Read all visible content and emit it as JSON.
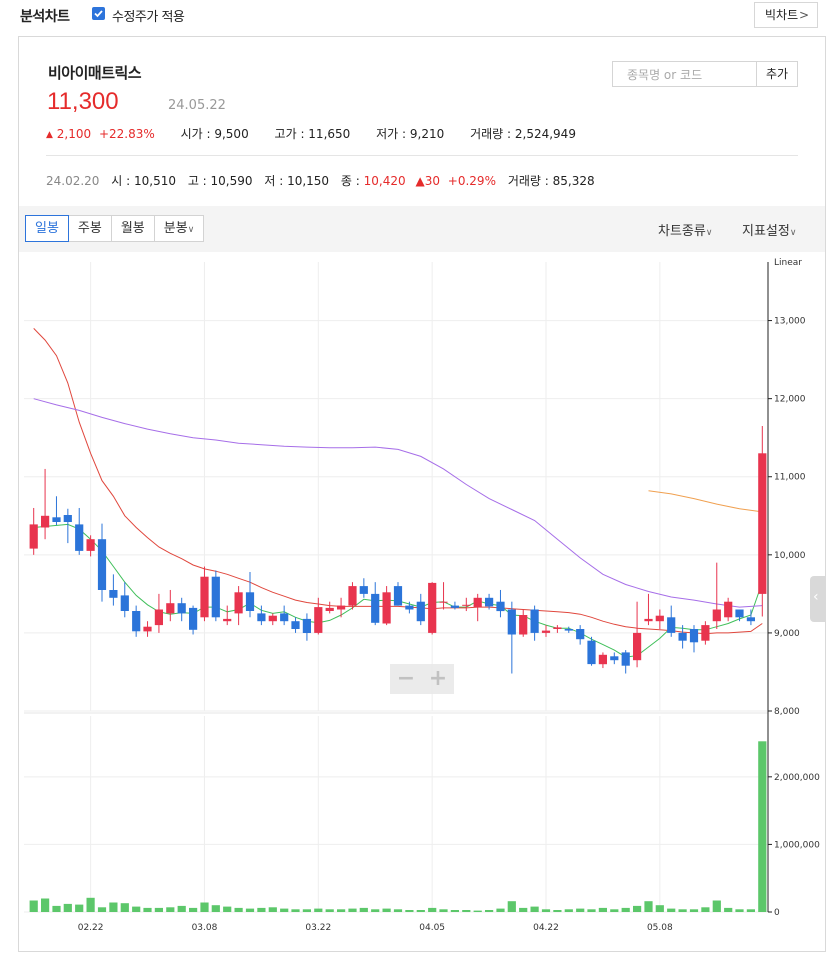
{
  "header": {
    "title": "분석차트",
    "adjusted_price_label": "수정주가 적용",
    "adjusted_price_checked": true,
    "big_chart_label": "빅차트",
    "big_chart_chevron": ">"
  },
  "stock": {
    "name": "비아이매트릭스",
    "price": "11,300",
    "date": "24.05.22",
    "change_arrow": "▲",
    "change": "2,100",
    "change_pct": "+22.83%",
    "open_label": "시가",
    "open": "9,500",
    "high_label": "고가",
    "high": "11,650",
    "low_label": "저가",
    "low": "9,210",
    "volume_label": "거래량",
    "volume": "2,524,949"
  },
  "search": {
    "placeholder": "종목명 or 코드",
    "value": "",
    "add_label": "추가"
  },
  "crosshair": {
    "date": "24.02.20",
    "open_label": "시",
    "open": "10,510",
    "high_label": "고",
    "high": "10,590",
    "low_label": "저",
    "low": "10,150",
    "close_label": "종",
    "close": "10,420",
    "change_arrow": "▲",
    "change": "30",
    "change_pct": "+0.29%",
    "volume_label": "거래량",
    "volume": "85,328"
  },
  "toolbar": {
    "tabs": [
      "일봉",
      "주봉",
      "월봉",
      "분봉"
    ],
    "active_tab": "일봉",
    "minute_chevron": "∨",
    "chart_type_label": "차트종류",
    "indicator_label": "지표설정",
    "dropdown_chevron": "∨"
  },
  "zoom": {
    "minus": "−",
    "plus": "+"
  },
  "colors": {
    "up": "#e8344e",
    "down": "#2b74d9",
    "ma5": "#3fbf5a",
    "ma20": "#e0473d",
    "ma60": "#a66ee8",
    "ma120": "#f0a050",
    "volume": "#5cc76a",
    "accent": "#2d74db"
  },
  "chart_data": {
    "type": "candlestick",
    "scale_label": "Linear",
    "price_axis": {
      "ylim": [
        8000,
        13750
      ],
      "ticks": [
        "13,000",
        "12,000",
        "11,000",
        "10,000",
        "9,000",
        "8,000"
      ],
      "tick_values": [
        13000,
        12000,
        11000,
        10000,
        9000,
        8000
      ]
    },
    "volume_axis": {
      "ylim": [
        0,
        2900000
      ],
      "ticks": [
        "2,000,000",
        "1,000,000",
        "0"
      ],
      "tick_values": [
        2000000,
        1000000,
        0
      ]
    },
    "x_ticks": [
      "02.22",
      "03.08",
      "03.22",
      "04.05",
      "04.22",
      "05.08"
    ],
    "x_tick_index": [
      5,
      15,
      25,
      35,
      45,
      55
    ],
    "candles": [
      {
        "o": 10080,
        "h": 10600,
        "l": 10000,
        "c": 10390
      },
      {
        "o": 10350,
        "h": 11100,
        "l": 10200,
        "c": 10500
      },
      {
        "o": 10480,
        "h": 10750,
        "l": 10380,
        "c": 10420
      },
      {
        "o": 10510,
        "h": 10590,
        "l": 10150,
        "c": 10420
      },
      {
        "o": 10390,
        "h": 10600,
        "l": 10000,
        "c": 10050
      },
      {
        "o": 10050,
        "h": 10250,
        "l": 9980,
        "c": 10200
      },
      {
        "o": 10200,
        "h": 10400,
        "l": 9400,
        "c": 9550
      },
      {
        "o": 9550,
        "h": 9750,
        "l": 9350,
        "c": 9450
      },
      {
        "o": 9480,
        "h": 9650,
        "l": 9200,
        "c": 9280
      },
      {
        "o": 9280,
        "h": 9350,
        "l": 8950,
        "c": 9020
      },
      {
        "o": 9020,
        "h": 9150,
        "l": 8950,
        "c": 9080
      },
      {
        "o": 9100,
        "h": 9500,
        "l": 9000,
        "c": 9300
      },
      {
        "o": 9250,
        "h": 9550,
        "l": 9150,
        "c": 9380
      },
      {
        "o": 9380,
        "h": 9450,
        "l": 9150,
        "c": 9250
      },
      {
        "o": 9320,
        "h": 9350,
        "l": 8980,
        "c": 9040
      },
      {
        "o": 9200,
        "h": 9850,
        "l": 9150,
        "c": 9720
      },
      {
        "o": 9720,
        "h": 9800,
        "l": 9150,
        "c": 9200
      },
      {
        "o": 9150,
        "h": 9350,
        "l": 9100,
        "c": 9180
      },
      {
        "o": 9250,
        "h": 9600,
        "l": 9100,
        "c": 9520
      },
      {
        "o": 9520,
        "h": 9780,
        "l": 9200,
        "c": 9280
      },
      {
        "o": 9250,
        "h": 9350,
        "l": 9100,
        "c": 9150
      },
      {
        "o": 9150,
        "h": 9250,
        "l": 9100,
        "c": 9220
      },
      {
        "o": 9250,
        "h": 9350,
        "l": 9100,
        "c": 9150
      },
      {
        "o": 9150,
        "h": 9200,
        "l": 9000,
        "c": 9050
      },
      {
        "o": 9180,
        "h": 9250,
        "l": 8900,
        "c": 9000
      },
      {
        "o": 9000,
        "h": 9450,
        "l": 8980,
        "c": 9330
      },
      {
        "o": 9280,
        "h": 9400,
        "l": 9250,
        "c": 9320
      },
      {
        "o": 9300,
        "h": 9450,
        "l": 9200,
        "c": 9350
      },
      {
        "o": 9350,
        "h": 9650,
        "l": 9300,
        "c": 9600
      },
      {
        "o": 9600,
        "h": 9700,
        "l": 9450,
        "c": 9500
      },
      {
        "o": 9500,
        "h": 9650,
        "l": 9100,
        "c": 9130
      },
      {
        "o": 9120,
        "h": 9600,
        "l": 9100,
        "c": 9520
      },
      {
        "o": 9600,
        "h": 9650,
        "l": 9350,
        "c": 9350
      },
      {
        "o": 9350,
        "h": 9400,
        "l": 9250,
        "c": 9300
      },
      {
        "o": 9400,
        "h": 9500,
        "l": 9100,
        "c": 9150
      },
      {
        "o": 9000,
        "h": 9650,
        "l": 8980,
        "c": 9640
      },
      {
        "o": 9400,
        "h": 9650,
        "l": 9300,
        "c": 9400
      },
      {
        "o": 9350,
        "h": 9400,
        "l": 9300,
        "c": 9320
      },
      {
        "o": 9350,
        "h": 9450,
        "l": 9280,
        "c": 9360
      },
      {
        "o": 9330,
        "h": 9500,
        "l": 9150,
        "c": 9450
      },
      {
        "o": 9450,
        "h": 9500,
        "l": 9300,
        "c": 9340
      },
      {
        "o": 9400,
        "h": 9550,
        "l": 9200,
        "c": 9280
      },
      {
        "o": 9300,
        "h": 9400,
        "l": 8480,
        "c": 8980
      },
      {
        "o": 8980,
        "h": 9300,
        "l": 8950,
        "c": 9230
      },
      {
        "o": 9300,
        "h": 9350,
        "l": 8900,
        "c": 9000
      },
      {
        "o": 9000,
        "h": 9100,
        "l": 8950,
        "c": 9030
      },
      {
        "o": 9050,
        "h": 9100,
        "l": 9000,
        "c": 9070
      },
      {
        "o": 9050,
        "h": 9080,
        "l": 9000,
        "c": 9030
      },
      {
        "o": 9050,
        "h": 9100,
        "l": 8850,
        "c": 8920
      },
      {
        "o": 8900,
        "h": 8950,
        "l": 8580,
        "c": 8600
      },
      {
        "o": 8600,
        "h": 8750,
        "l": 8550,
        "c": 8720
      },
      {
        "o": 8700,
        "h": 8750,
        "l": 8600,
        "c": 8650
      },
      {
        "o": 8750,
        "h": 8780,
        "l": 8480,
        "c": 8580
      },
      {
        "o": 8650,
        "h": 9400,
        "l": 8560,
        "c": 9000
      },
      {
        "o": 9150,
        "h": 9500,
        "l": 9100,
        "c": 9180
      },
      {
        "o": 9150,
        "h": 9300,
        "l": 9050,
        "c": 9220
      },
      {
        "o": 9200,
        "h": 9350,
        "l": 8950,
        "c": 9000
      },
      {
        "o": 9000,
        "h": 9100,
        "l": 8800,
        "c": 8900
      },
      {
        "o": 9050,
        "h": 9100,
        "l": 8750,
        "c": 8880
      },
      {
        "o": 8900,
        "h": 9150,
        "l": 8850,
        "c": 9100
      },
      {
        "o": 9150,
        "h": 9900,
        "l": 9050,
        "c": 9300
      },
      {
        "o": 9200,
        "h": 9450,
        "l": 9150,
        "c": 9400
      },
      {
        "o": 9300,
        "h": 9300,
        "l": 9150,
        "c": 9200
      },
      {
        "o": 9200,
        "h": 9300,
        "l": 9100,
        "c": 9150
      },
      {
        "o": 9500,
        "h": 11650,
        "l": 9210,
        "c": 11300
      }
    ],
    "volumes": [
      170000,
      200000,
      90000,
      120000,
      110000,
      210000,
      70000,
      140000,
      130000,
      80000,
      60000,
      60000,
      70000,
      90000,
      60000,
      140000,
      100000,
      80000,
      60000,
      50000,
      60000,
      70000,
      50000,
      40000,
      40000,
      50000,
      40000,
      40000,
      50000,
      60000,
      40000,
      50000,
      40000,
      30000,
      30000,
      60000,
      40000,
      30000,
      30000,
      20000,
      30000,
      50000,
      160000,
      60000,
      80000,
      40000,
      30000,
      40000,
      50000,
      40000,
      60000,
      40000,
      60000,
      90000,
      160000,
      100000,
      50000,
      40000,
      40000,
      70000,
      170000,
      60000,
      40000,
      40000,
      2524949
    ],
    "ma_series": [
      {
        "key": "ma5",
        "points": [
          [
            0,
            10350
          ],
          [
            3,
            10390
          ],
          [
            4,
            10330
          ],
          [
            5,
            10200
          ],
          [
            6,
            10050
          ],
          [
            7,
            9850
          ],
          [
            8,
            9650
          ],
          [
            9,
            9480
          ],
          [
            10,
            9360
          ],
          [
            11,
            9270
          ],
          [
            12,
            9240
          ],
          [
            13,
            9260
          ],
          [
            14,
            9250
          ],
          [
            15,
            9330
          ],
          [
            16,
            9330
          ],
          [
            17,
            9270
          ],
          [
            18,
            9300
          ],
          [
            19,
            9380
          ],
          [
            20,
            9290
          ],
          [
            21,
            9250
          ],
          [
            22,
            9270
          ],
          [
            23,
            9200
          ],
          [
            24,
            9150
          ],
          [
            25,
            9130
          ],
          [
            26,
            9160
          ],
          [
            27,
            9230
          ],
          [
            28,
            9320
          ],
          [
            29,
            9430
          ],
          [
            30,
            9410
          ],
          [
            31,
            9420
          ],
          [
            32,
            9410
          ],
          [
            33,
            9370
          ],
          [
            34,
            9330
          ],
          [
            35,
            9390
          ],
          [
            36,
            9400
          ],
          [
            37,
            9330
          ],
          [
            38,
            9330
          ],
          [
            39,
            9410
          ],
          [
            40,
            9370
          ],
          [
            41,
            9350
          ],
          [
            42,
            9230
          ],
          [
            43,
            9220
          ],
          [
            44,
            9150
          ],
          [
            45,
            9100
          ],
          [
            46,
            9060
          ],
          [
            47,
            9060
          ],
          [
            48,
            9000
          ],
          [
            49,
            8920
          ],
          [
            50,
            8850
          ],
          [
            51,
            8780
          ],
          [
            52,
            8690
          ],
          [
            53,
            8710
          ],
          [
            54,
            8820
          ],
          [
            55,
            8930
          ],
          [
            56,
            9070
          ],
          [
            57,
            9060
          ],
          [
            58,
            9040
          ],
          [
            59,
            9040
          ],
          [
            60,
            9080
          ],
          [
            61,
            9120
          ],
          [
            62,
            9180
          ],
          [
            63,
            9230
          ],
          [
            64,
            9650
          ]
        ]
      },
      {
        "key": "ma20",
        "points": [
          [
            0,
            12900
          ],
          [
            1,
            12750
          ],
          [
            2,
            12550
          ],
          [
            3,
            12200
          ],
          [
            4,
            11700
          ],
          [
            5,
            11300
          ],
          [
            6,
            10950
          ],
          [
            7,
            10750
          ],
          [
            8,
            10500
          ],
          [
            9,
            10350
          ],
          [
            10,
            10220
          ],
          [
            11,
            10100
          ],
          [
            12,
            10020
          ],
          [
            13,
            9950
          ],
          [
            14,
            9870
          ],
          [
            15,
            9820
          ],
          [
            16,
            9790
          ],
          [
            17,
            9750
          ],
          [
            18,
            9700
          ],
          [
            19,
            9650
          ],
          [
            20,
            9580
          ],
          [
            21,
            9520
          ],
          [
            22,
            9470
          ],
          [
            23,
            9420
          ],
          [
            24,
            9390
          ],
          [
            25,
            9370
          ],
          [
            26,
            9350
          ],
          [
            27,
            9340
          ],
          [
            28,
            9340
          ],
          [
            29,
            9340
          ],
          [
            30,
            9340
          ],
          [
            31,
            9340
          ],
          [
            32,
            9340
          ],
          [
            33,
            9330
          ],
          [
            34,
            9320
          ],
          [
            35,
            9310
          ],
          [
            36,
            9320
          ],
          [
            37,
            9320
          ],
          [
            38,
            9320
          ],
          [
            39,
            9330
          ],
          [
            40,
            9330
          ],
          [
            41,
            9320
          ],
          [
            42,
            9310
          ],
          [
            43,
            9300
          ],
          [
            44,
            9290
          ],
          [
            45,
            9280
          ],
          [
            46,
            9270
          ],
          [
            47,
            9260
          ],
          [
            48,
            9240
          ],
          [
            49,
            9200
          ],
          [
            50,
            9150
          ],
          [
            51,
            9110
          ],
          [
            52,
            9080
          ],
          [
            53,
            9060
          ],
          [
            54,
            9050
          ],
          [
            55,
            9040
          ],
          [
            56,
            9030
          ],
          [
            57,
            9010
          ],
          [
            58,
            9000
          ],
          [
            59,
            8990
          ],
          [
            60,
            9000
          ],
          [
            61,
            9000
          ],
          [
            62,
            9010
          ],
          [
            63,
            9020
          ],
          [
            64,
            9120
          ]
        ]
      },
      {
        "key": "ma60",
        "points": [
          [
            0,
            12000
          ],
          [
            2,
            11920
          ],
          [
            4,
            11850
          ],
          [
            6,
            11760
          ],
          [
            8,
            11680
          ],
          [
            10,
            11610
          ],
          [
            12,
            11550
          ],
          [
            14,
            11500
          ],
          [
            16,
            11470
          ],
          [
            18,
            11430
          ],
          [
            20,
            11410
          ],
          [
            22,
            11390
          ],
          [
            24,
            11380
          ],
          [
            26,
            11370
          ],
          [
            28,
            11370
          ],
          [
            30,
            11380
          ],
          [
            32,
            11350
          ],
          [
            34,
            11260
          ],
          [
            36,
            11100
          ],
          [
            38,
            10900
          ],
          [
            40,
            10720
          ],
          [
            42,
            10580
          ],
          [
            44,
            10440
          ],
          [
            46,
            10200
          ],
          [
            48,
            9960
          ],
          [
            50,
            9750
          ],
          [
            52,
            9620
          ],
          [
            54,
            9530
          ],
          [
            56,
            9460
          ],
          [
            58,
            9420
          ],
          [
            60,
            9370
          ],
          [
            62,
            9330
          ],
          [
            64,
            9350
          ]
        ]
      },
      {
        "key": "ma120",
        "points": [
          [
            54,
            10820
          ],
          [
            56,
            10780
          ],
          [
            58,
            10720
          ],
          [
            60,
            10650
          ],
          [
            62,
            10590
          ],
          [
            64,
            10550
          ]
        ]
      }
    ]
  }
}
